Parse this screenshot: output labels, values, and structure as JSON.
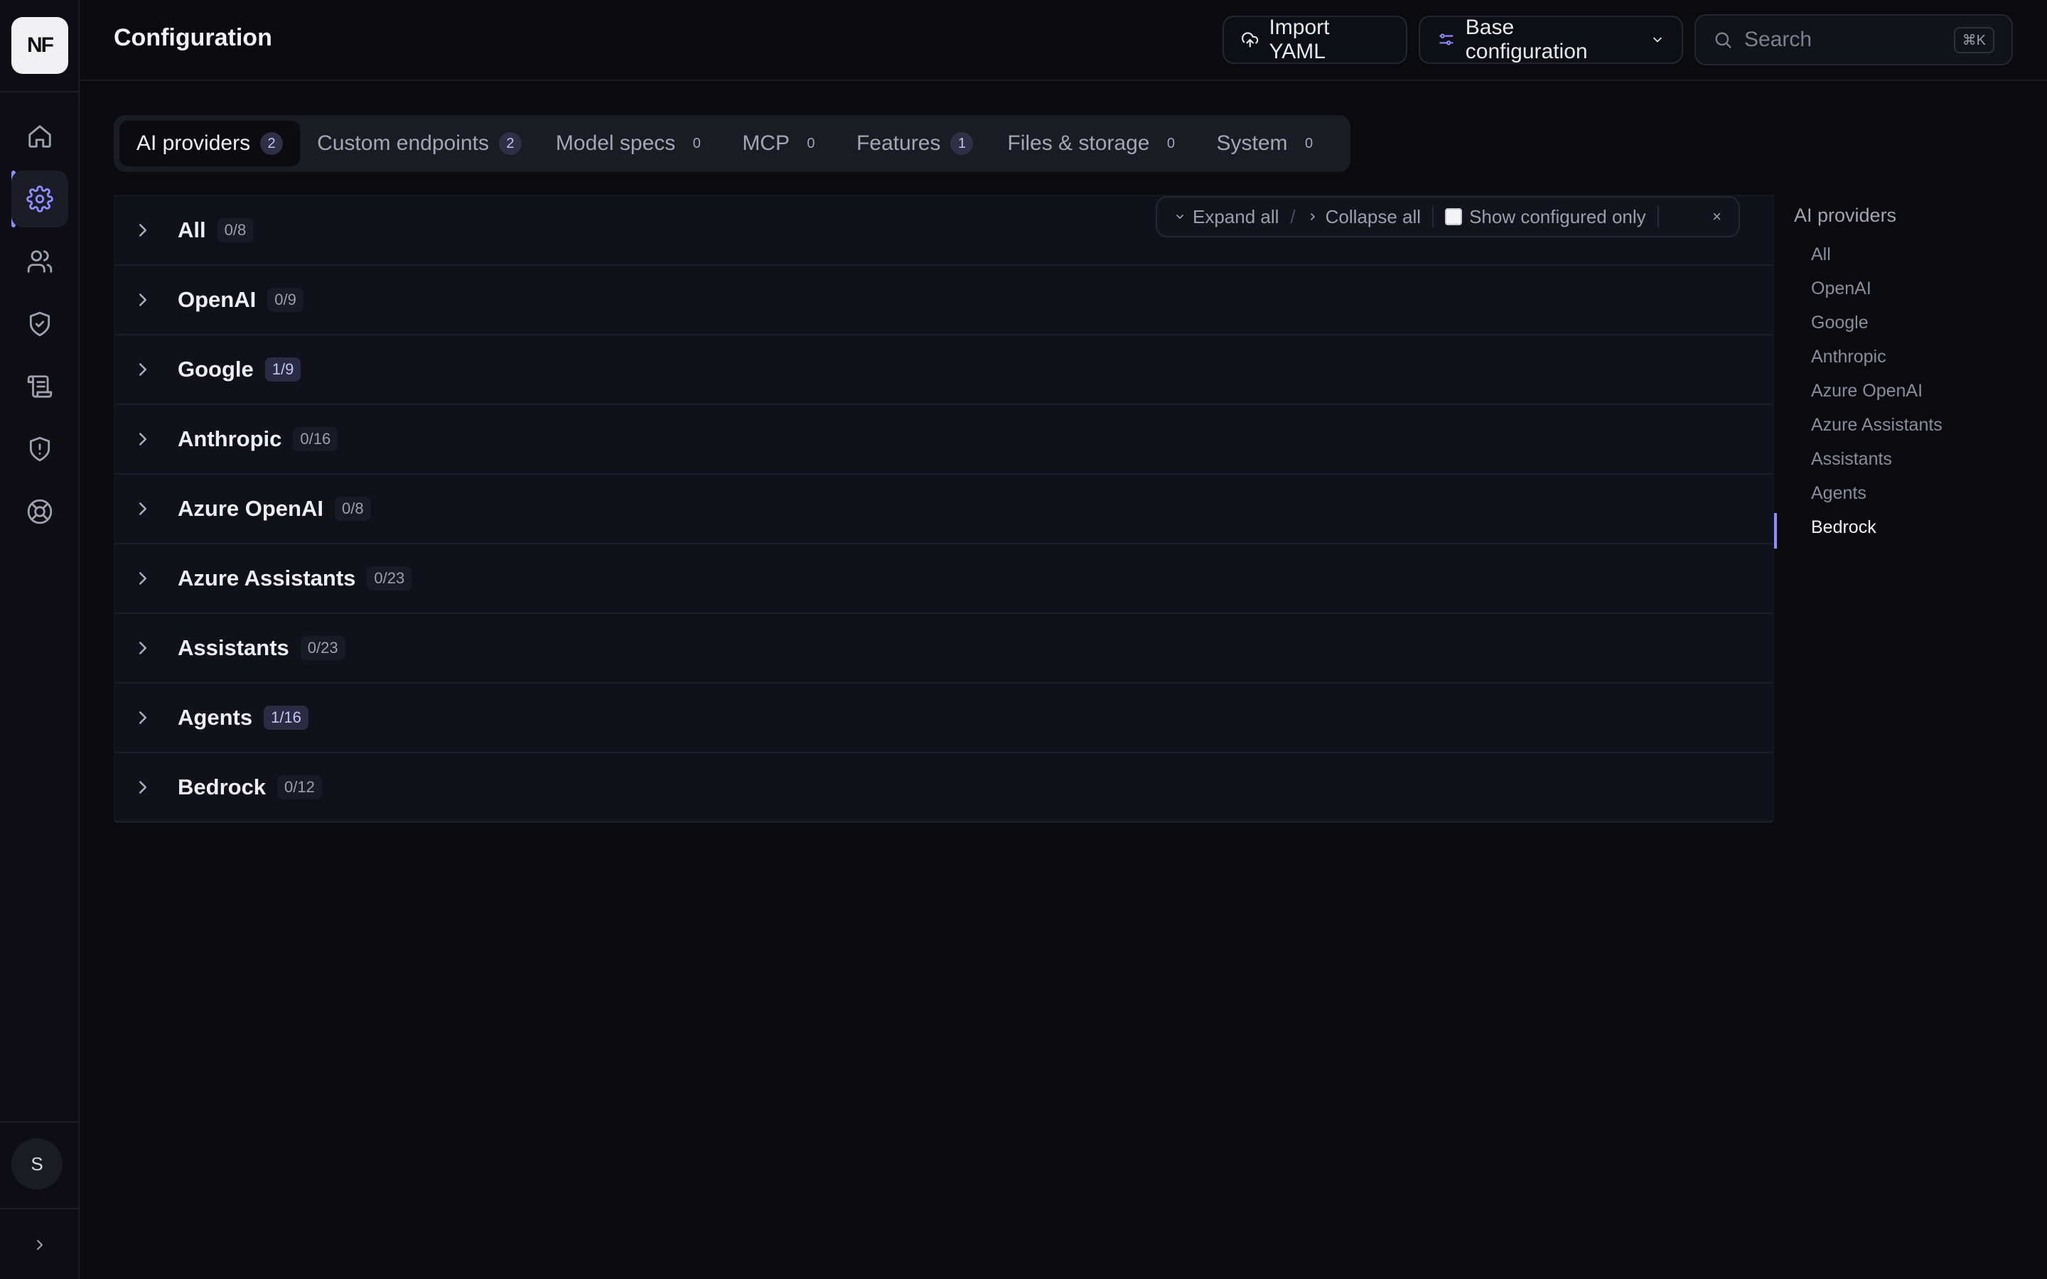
{
  "app": {
    "logo_text": "NF",
    "avatar_initial": "S"
  },
  "nav": [
    {
      "name": "home",
      "icon": "home-icon"
    },
    {
      "name": "settings",
      "icon": "gear-icon",
      "active": true
    },
    {
      "name": "users",
      "icon": "users-icon"
    },
    {
      "name": "security",
      "icon": "shield-check-icon"
    },
    {
      "name": "logs",
      "icon": "scroll-icon"
    },
    {
      "name": "alerts",
      "icon": "shield-alert-icon"
    },
    {
      "name": "help",
      "icon": "lifebuoy-icon"
    }
  ],
  "header": {
    "title": "Configuration",
    "import_label": "Import YAML",
    "base_label": "Base configuration",
    "search_placeholder": "Search",
    "search_shortcut": "⌘K"
  },
  "tabs": [
    {
      "label": "AI providers",
      "count": "2",
      "active": true,
      "highlight": true
    },
    {
      "label": "Custom endpoints",
      "count": "2",
      "highlight": true
    },
    {
      "label": "Model specs",
      "count": "0"
    },
    {
      "label": "MCP",
      "count": "0"
    },
    {
      "label": "Features",
      "count": "1",
      "highlight": true
    },
    {
      "label": "Files & storage",
      "count": "0"
    },
    {
      "label": "System",
      "count": "0"
    }
  ],
  "toolbar": {
    "expand_all": "Expand all",
    "separator": "/",
    "collapse_all": "Collapse all",
    "show_configured": "Show configured only",
    "close": "×"
  },
  "providers": [
    {
      "label": "All",
      "badge": "0/8"
    },
    {
      "label": "OpenAI",
      "badge": "0/9"
    },
    {
      "label": "Google",
      "badge": "1/9",
      "highlight": true
    },
    {
      "label": "Anthropic",
      "badge": "0/16"
    },
    {
      "label": "Azure OpenAI",
      "badge": "0/8"
    },
    {
      "label": "Azure Assistants",
      "badge": "0/23"
    },
    {
      "label": "Assistants",
      "badge": "0/23"
    },
    {
      "label": "Agents",
      "badge": "1/16",
      "highlight": true
    },
    {
      "label": "Bedrock",
      "badge": "0/12"
    }
  ],
  "toc": {
    "title": "AI providers",
    "items": [
      "All",
      "OpenAI",
      "Google",
      "Anthropic",
      "Azure OpenAI",
      "Azure Assistants",
      "Assistants",
      "Agents",
      "Bedrock"
    ],
    "active": "Bedrock"
  },
  "colors": {
    "accent": "#8c8dff",
    "background": "#0a0a0f",
    "panel": "#11111a"
  }
}
